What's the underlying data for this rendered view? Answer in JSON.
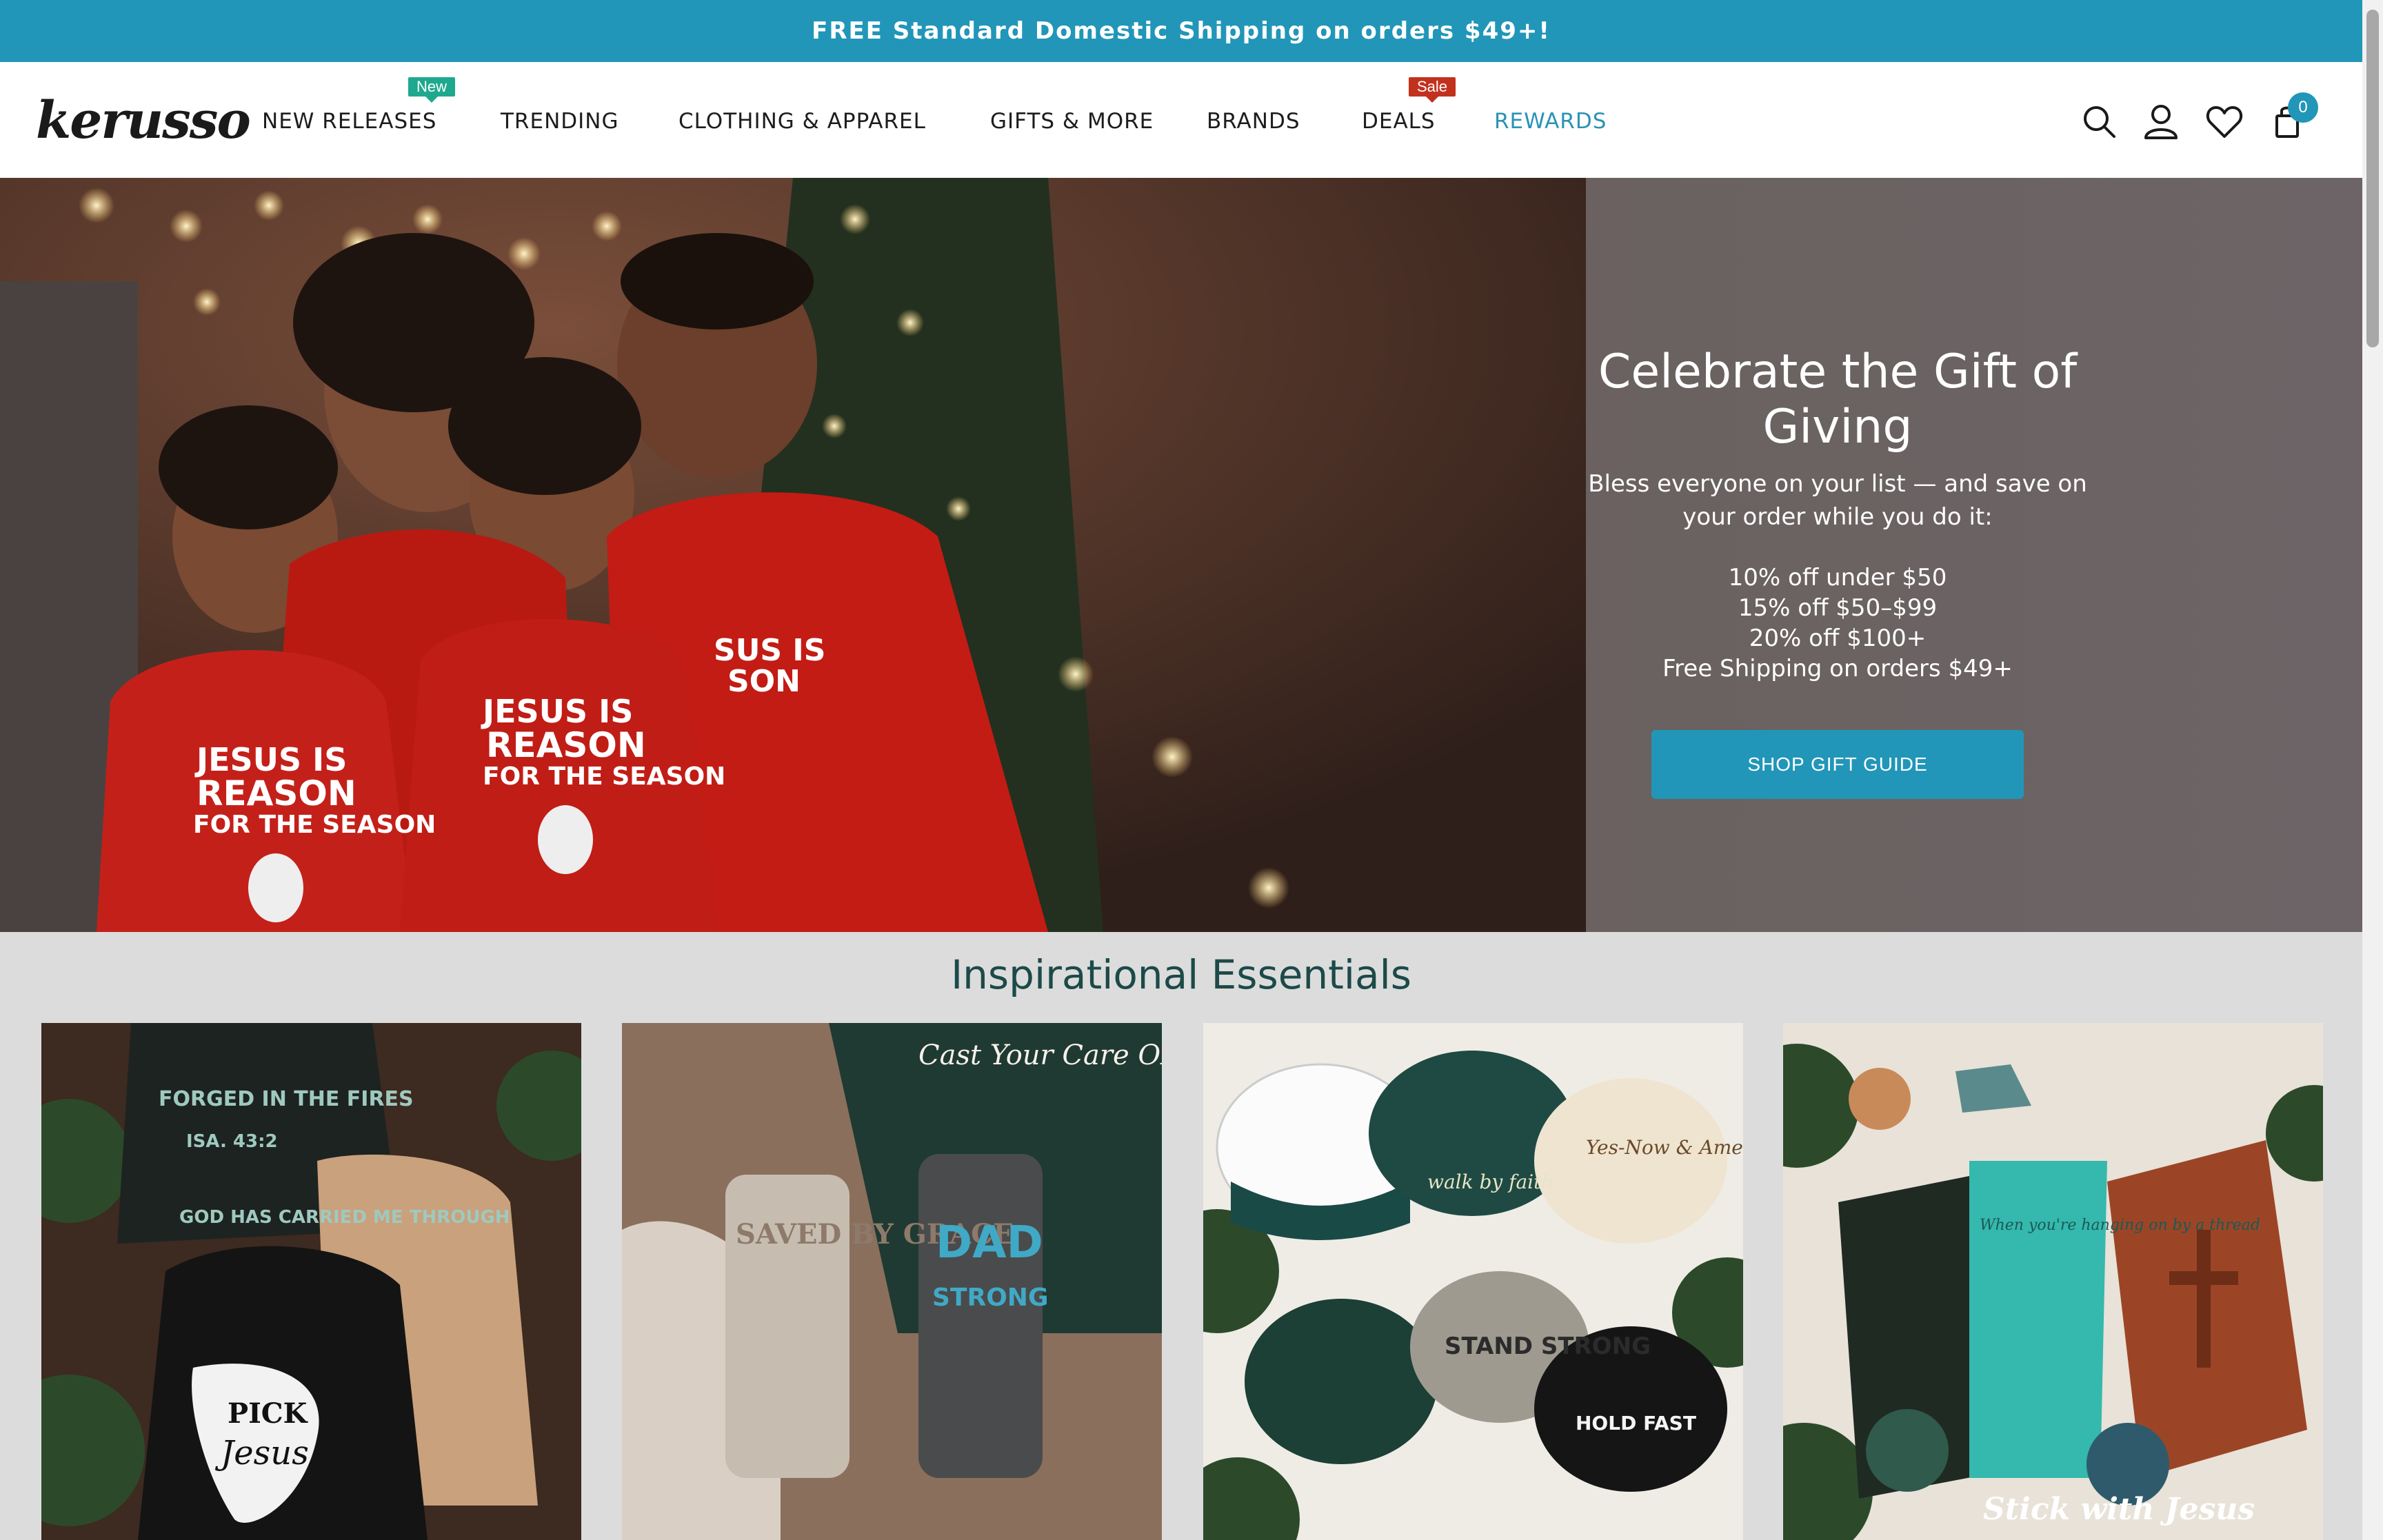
{
  "announcement": "FREE Standard Domestic Shipping on orders $49+!",
  "logo": {
    "text": "kerusso",
    "icon": "kerusso-logo"
  },
  "nav": [
    {
      "label": "NEW RELEASES",
      "badge": "New"
    },
    {
      "label": "TRENDING"
    },
    {
      "label": "CLOTHING & APPAREL"
    },
    {
      "label": "GIFTS & MORE"
    },
    {
      "label": "BRANDS"
    },
    {
      "label": "DEALS",
      "badge": "Sale"
    },
    {
      "label": "REWARDS"
    }
  ],
  "header_icons": [
    "search-icon",
    "account-icon",
    "wishlist-icon",
    "cart-icon"
  ],
  "cart_count": "0",
  "hero": {
    "title": "Celebrate the Gift of Giving",
    "subtitle": "Bless everyone on your list — and save on your order while you do it:",
    "offers": [
      "10% off under $50",
      "15% off $50–$99",
      "20% off $100+",
      "Free Shipping on orders $49+"
    ],
    "button": "SHOP GIFT GUIDE",
    "shirt_text": [
      "JESUS IS THE",
      "REASON",
      "FOR THE SEASON"
    ]
  },
  "section": {
    "title": "Inspirational Essentials",
    "cards": [
      {
        "art": [
          "FORGED IN THE FIRES",
          "ISA. 43:2",
          "GOD HAS CARRIED ME THROUGH",
          "PICK",
          "Jesus"
        ]
      },
      {
        "art": [
          "Cast Your Care ON THE LORD",
          "SAVED BY GRACE",
          "DAD",
          "STRONG"
        ]
      },
      {
        "art": [
          "walk by faith",
          "Yes-Now & Amen",
          "STAND STRONG",
          "HOLD FAST"
        ]
      },
      {
        "art": [
          "When you're hanging on by a thread",
          "Stick with Jesus"
        ]
      }
    ]
  },
  "colors": {
    "accent": "#2196b8",
    "new_badge": "#1ea98e",
    "sale_badge": "#c2311e",
    "section_title": "#1c4a48"
  }
}
